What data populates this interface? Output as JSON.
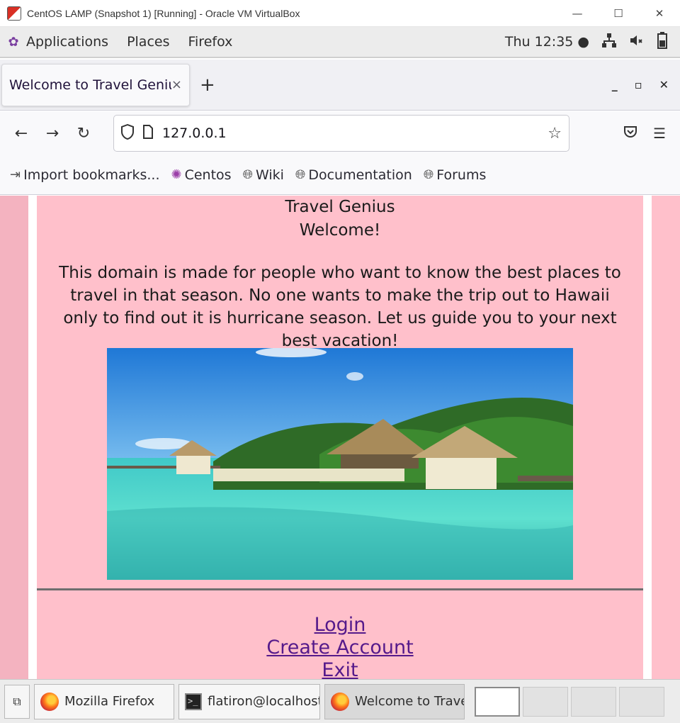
{
  "vbox": {
    "title": "CentOS LAMP (Snapshot 1) [Running] - Oracle VM VirtualBox",
    "minimize": "—",
    "maximize": "☐",
    "close": "✕"
  },
  "gnome": {
    "applications": "Applications",
    "places": "Places",
    "firefox": "Firefox",
    "clock": "Thu 12:35 ●"
  },
  "browser": {
    "tab_title": "Welcome to Travel Genius",
    "tab_close": "×",
    "new_tab": "+",
    "url": "127.0.0.1",
    "bookmarks": [
      {
        "label": "Import bookmarks...",
        "icon": "import-icon"
      },
      {
        "label": "Centos",
        "icon": "centos-icon"
      },
      {
        "label": "Wiki",
        "icon": "globe-icon"
      },
      {
        "label": "Documentation",
        "icon": "globe-icon"
      },
      {
        "label": "Forums",
        "icon": "globe-icon"
      }
    ]
  },
  "page": {
    "site_title": "Travel Genius",
    "welcome": "Welcome!",
    "intro": "This domain is made for people who want to know the best places to travel in that season. No one wants to make the trip out to Hawaii only to find out it is hurricane season. Let us guide you to your next best vacation!",
    "links": {
      "login": "Login",
      "create_account": "Create Account",
      "exit": "Exit"
    }
  },
  "taskbar": {
    "items": [
      {
        "label": "Mozilla Firefox"
      },
      {
        "label": "flatiron@localhost:/..."
      },
      {
        "label": "Welcome to Travel ..."
      }
    ],
    "workspace_count": 4,
    "active_workspace": 1
  },
  "colors": {
    "page_background": "#ffc0cb",
    "link": "#551a8b"
  }
}
